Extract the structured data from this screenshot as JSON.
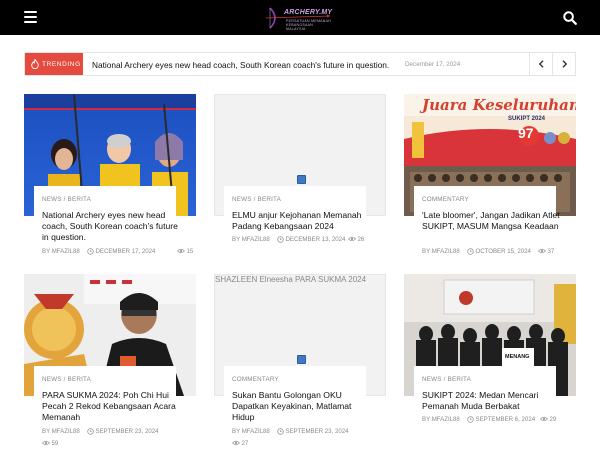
{
  "header": {
    "logo_text": "ARCHERY.MY",
    "logo_subtext": "PERSATUAN MEMANAH KEBANGSAAN MALAYSIA",
    "menu_icon": "hamburger-menu-icon",
    "search_icon": "search-icon",
    "background_color": "#000000"
  },
  "trending": {
    "label": "TRENDING",
    "icon": "fire-icon",
    "accent_color": "#e44b3e",
    "headline": "National Archery eyes new head coach, South Korean coach's future in question.",
    "date": "December 17, 2024",
    "prev_icon": "chevron-left-icon",
    "next_icon": "chevron-right-icon"
  },
  "articles": [
    {
      "category": "NEWS / BERITA",
      "title": "National Archery eyes new head coach, South Korean coach's future in question.",
      "author": "BY MFAZIL88",
      "date": "DECEMBER 17, 2024",
      "views": "15",
      "image": "archers-team-photo"
    },
    {
      "category": "NEWS / BERITA",
      "title": "ELMU anjur Kejohanan Memanah Padang Kebangsaan 2024",
      "author": "BY MFAZIL88",
      "date": "DECEMBER 13, 2024",
      "views": "26",
      "image": "placeholder"
    },
    {
      "category": "COMMENTARY",
      "title": "'Late bloomer', Jangan Jadikan Atlet SUKIPT, MASUM Mangsa Keadaan",
      "author": "BY MFAZIL88",
      "date": "OCTOBER 15, 2024",
      "views": "37",
      "image": "juara-keseluruhan-poster",
      "image_text": "Juara Keseluruhan",
      "image_subtext": "SUKIPT 2024",
      "image_number": "97"
    },
    {
      "category": "NEWS / BERITA",
      "title": "PARA SUKMA 2024: Poh Chi Hui Pecah 2 Rekod Kebangsaan Acara Memanah",
      "author": "BY MFAZIL88",
      "date": "SEPTEMBER 23, 2024",
      "views": "59",
      "image": "athlete-with-medal"
    },
    {
      "category": "COMMENTARY",
      "title": "Sukan Bantu Golongan OKU Dapatkan Keyakinan, Matlamat Hidup",
      "author": "BY MFAZIL88",
      "date": "SEPTEMBER 23, 2024",
      "views": "27",
      "image": "placeholder",
      "image_alt": "SHAZLEEN Elneesha PARA SUKMA 2024"
    },
    {
      "category": "NEWS / BERITA",
      "title": "SUKIPT 2024: Medan Mencari Pemanah Muda Berbakat",
      "author": "BY MFAZIL88",
      "date": "SEPTEMBER 6, 2024",
      "views": "29",
      "image": "team-group-photo",
      "image_text": "MENANG"
    }
  ]
}
